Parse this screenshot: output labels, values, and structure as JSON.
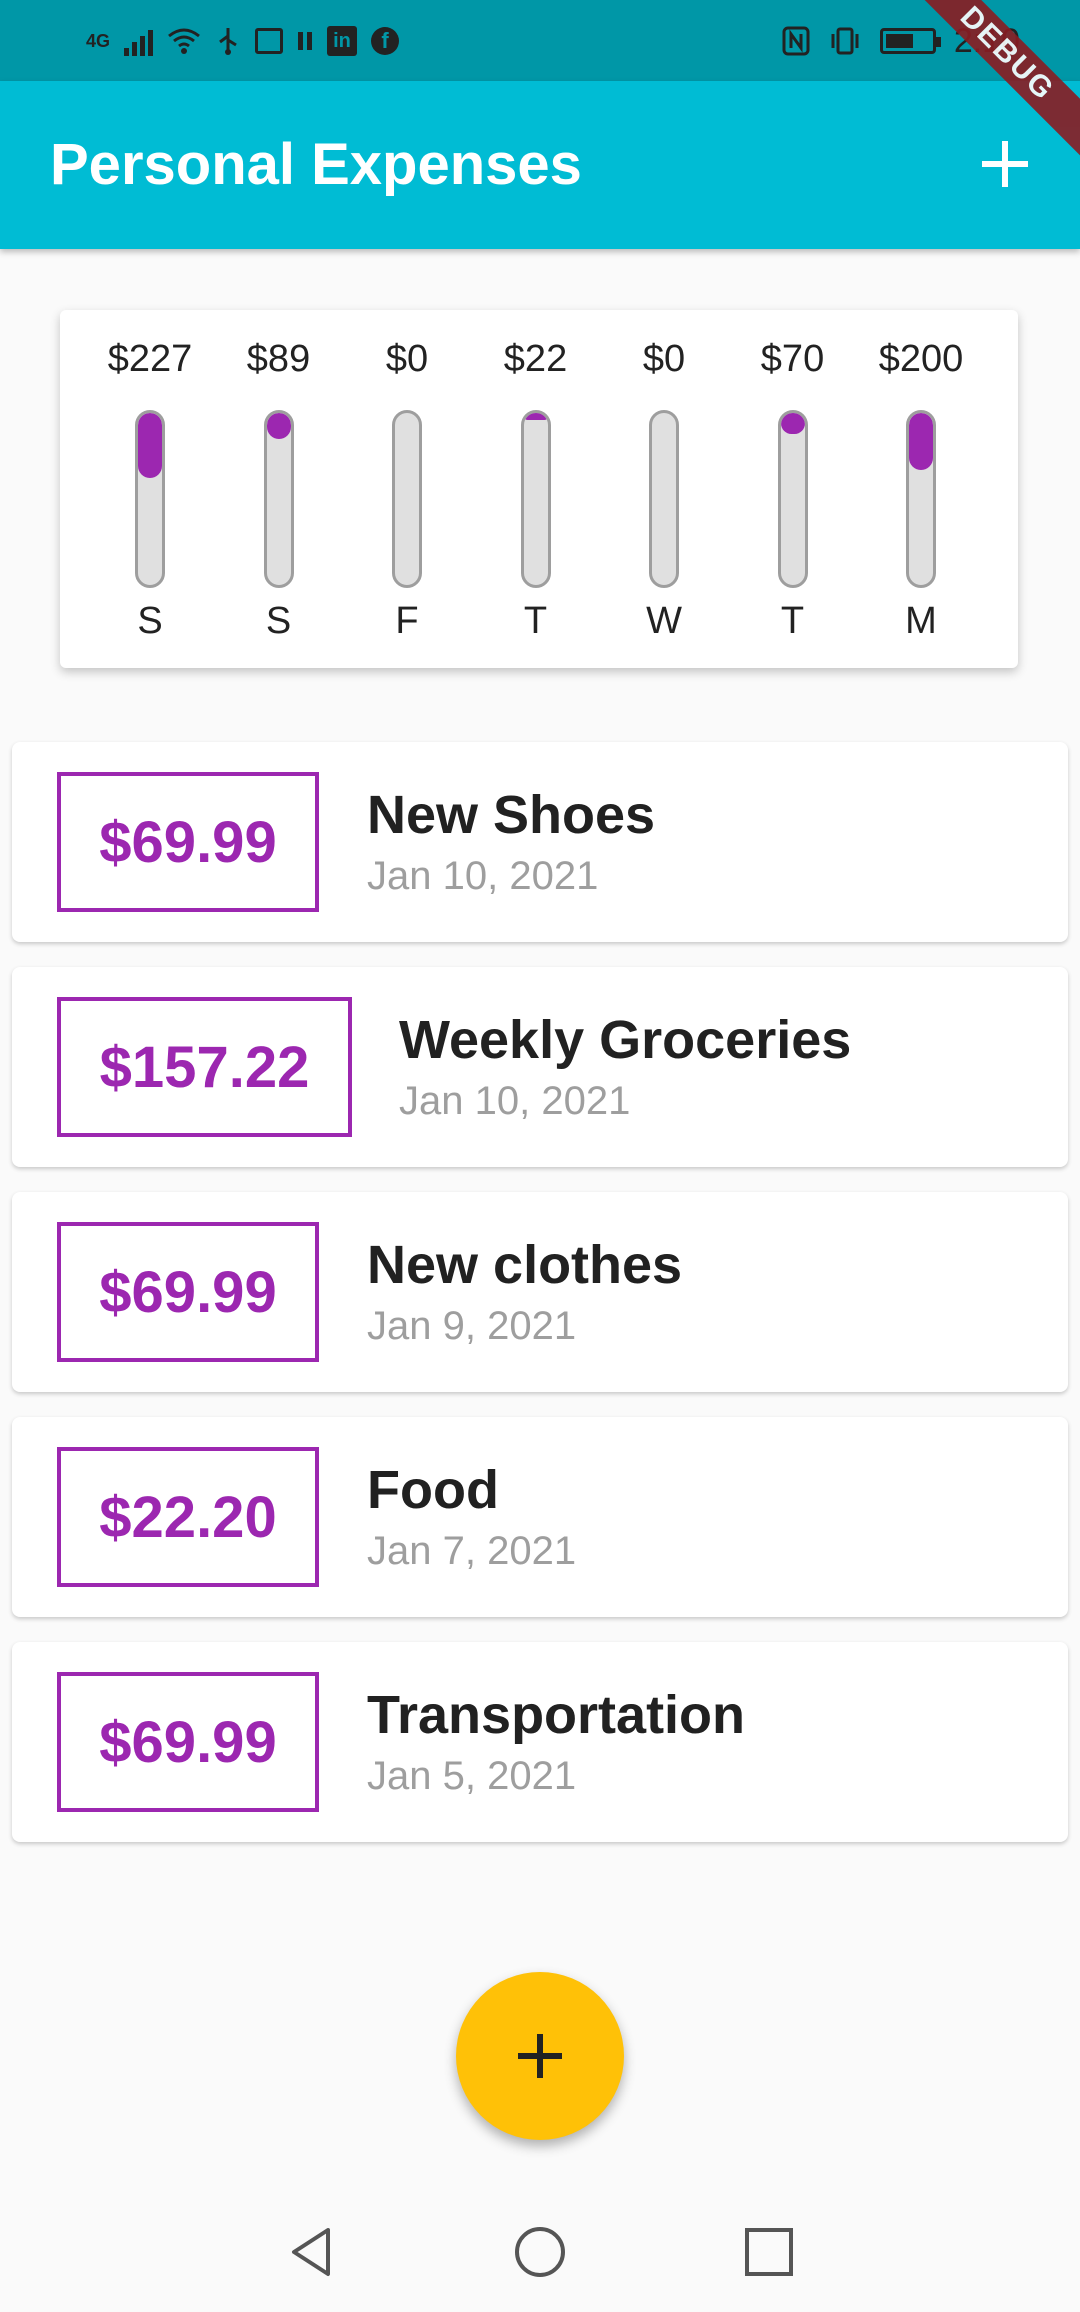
{
  "status_bar": {
    "time": "2:10",
    "network": "4G",
    "icons": [
      "signal-icon",
      "wifi-icon",
      "usb-icon",
      "cast-icon",
      "pause-icon",
      "linkedin-icon",
      "facebook-icon",
      "nfc-icon",
      "vibrate-icon",
      "battery-icon"
    ]
  },
  "debug_label": "DEBUG",
  "app_bar": {
    "title": "Personal Expenses",
    "add_icon": "plus-icon"
  },
  "chart_data": {
    "type": "bar",
    "categories": [
      "S",
      "S",
      "F",
      "T",
      "W",
      "T",
      "M"
    ],
    "amounts": [
      "$227",
      "$89",
      "$0",
      "$22",
      "$0",
      "$70",
      "$200"
    ],
    "values": [
      227,
      89,
      0,
      22,
      0,
      70,
      200
    ],
    "fill_fraction": [
      0.38,
      0.15,
      0.0,
      0.04,
      0.0,
      0.12,
      0.33
    ],
    "bar_color": "#9c27b0",
    "track_color": "#e0e0e0"
  },
  "transactions": [
    {
      "amount": "$69.99",
      "title": "New Shoes",
      "date": "Jan 10, 2021"
    },
    {
      "amount": "$157.22",
      "title": "Weekly Groceries",
      "date": "Jan 10, 2021"
    },
    {
      "amount": "$69.99",
      "title": "New clothes",
      "date": "Jan 9, 2021"
    },
    {
      "amount": "$22.20",
      "title": "Food",
      "date": "Jan 7, 2021"
    },
    {
      "amount": "$69.99",
      "title": "Transportation",
      "date": "Jan 5, 2021"
    }
  ],
  "fab": {
    "icon": "plus-icon",
    "color": "#ffc107"
  },
  "nav": {
    "back_icon": "back-icon",
    "home_icon": "home-icon",
    "recents_icon": "recents-icon"
  },
  "colors": {
    "primary": "#00bcd4",
    "accent": "#9c27b0",
    "fab": "#ffc107"
  }
}
